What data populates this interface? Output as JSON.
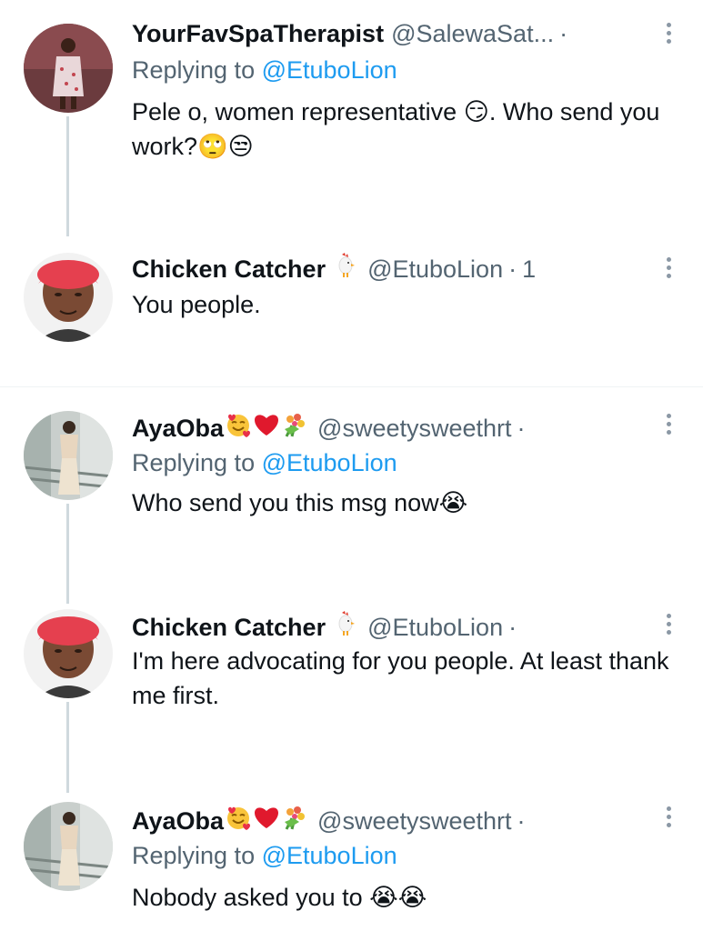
{
  "tweets": [
    {
      "name": "YourFavSpaTherapist",
      "handle": "@SalewaSat...",
      "dot": "·",
      "time": "",
      "replying_prefix": "Replying to",
      "replying_to": "@EtuboLion",
      "text": "Pele o, women representative 😏. Who send you work?🙄😒"
    },
    {
      "name": "Chicken Catcher",
      "handle": "@EtuboLion",
      "dot": "·",
      "time": "1",
      "text": "You people."
    },
    {
      "name": "AyaOba",
      "handle": "@sweetysweethrt",
      "dot": "·",
      "time": "",
      "replying_prefix": "Replying to",
      "replying_to": "@EtuboLion",
      "text": "Who send you this msg now😭"
    },
    {
      "name": "Chicken Catcher",
      "handle": "@EtuboLion",
      "dot": "·",
      "time": "",
      "text": "I'm here advocating for you people. At least thank me first."
    },
    {
      "name": "AyaOba",
      "handle": "@sweetysweethrt",
      "dot": "·",
      "time": "",
      "replying_prefix": "Replying to",
      "replying_to": "@EtuboLion",
      "text": "Nobody asked you to 😭😭"
    }
  ],
  "icons": {
    "more": "more-options-icon",
    "chicken": "chicken-icon",
    "name_emojis": [
      "smiling-face-with-hearts-icon",
      "red-heart-icon",
      "bouquet-icon"
    ]
  },
  "colors": {
    "text": "#0f1419",
    "secondary": "#536471",
    "link": "#1d9bf0",
    "thread_line": "#cfd9de"
  }
}
